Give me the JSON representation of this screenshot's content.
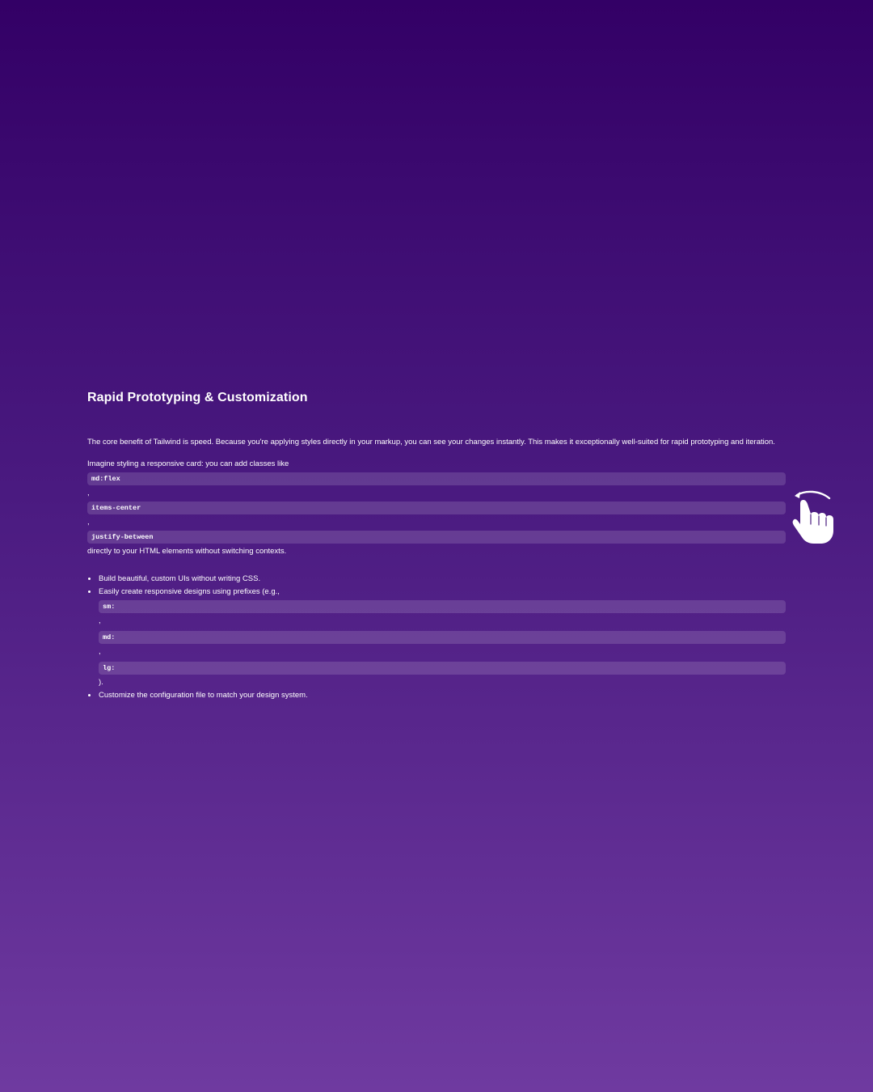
{
  "section": {
    "title": "Rapid Prototyping & Customization",
    "intro": "The core benefit of Tailwind is speed. Because you're applying styles directly in your markup, you can see your changes instantly. This makes it exceptionally well-suited for rapid prototyping and iteration.",
    "example_lead": "Imagine styling a responsive card: you can add classes like",
    "example_classes": [
      "md:flex",
      "items-center",
      "justify-between"
    ],
    "separator": ",",
    "example_tail": "directly to your HTML elements without switching contexts."
  },
  "features": {
    "item1": "Build beautiful, custom UIs without writing CSS.",
    "item2_lead": "Easily create responsive designs using prefixes (e.g.,",
    "item2_prefixes": [
      "sm:",
      "md:",
      "lg:"
    ],
    "item2_tail": ").",
    "item3": "Customize the configuration file to match your design system."
  },
  "icons": {
    "pointer": "swipe-hand-icon"
  }
}
